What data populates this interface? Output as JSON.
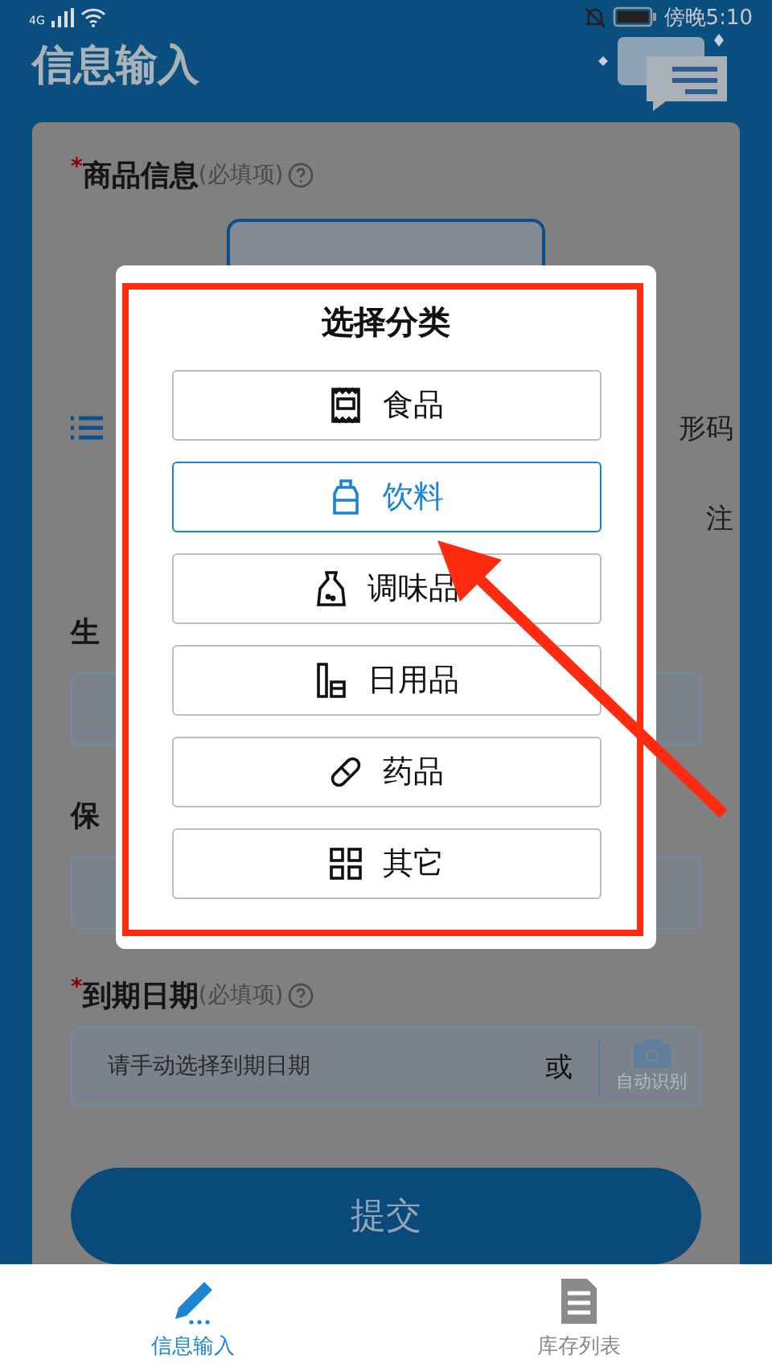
{
  "status_bar": {
    "network": "4G",
    "time": "傍晚5:10"
  },
  "header": {
    "title": "信息输入"
  },
  "product": {
    "mark": "*",
    "label": "商品信息",
    "hint": "(必填项)"
  },
  "side_fragments": [
    {
      "right": "形码"
    },
    {
      "right": "注"
    }
  ],
  "partial_fields": [
    {
      "label": "生"
    },
    {
      "label": "保"
    }
  ],
  "expiry": {
    "mark": "*",
    "label": "到期日期",
    "hint": "(必填项)",
    "placeholder": "请手动选择到期日期",
    "or": "或",
    "auto": "自动识别"
  },
  "submit": "提交",
  "dialog": {
    "title": "选择分类",
    "options": [
      {
        "label": "食品",
        "kind": "food",
        "selected": false
      },
      {
        "label": "饮料",
        "kind": "drink",
        "selected": true
      },
      {
        "label": "调味品",
        "kind": "seasoning",
        "selected": false
      },
      {
        "label": "日用品",
        "kind": "daily",
        "selected": false
      },
      {
        "label": "药品",
        "kind": "medicine",
        "selected": false
      },
      {
        "label": "其它",
        "kind": "other",
        "selected": false
      }
    ]
  },
  "tabs": [
    {
      "label": "信息输入",
      "kind": "input",
      "selected": true
    },
    {
      "label": "库存列表",
      "kind": "list",
      "selected": false
    }
  ]
}
